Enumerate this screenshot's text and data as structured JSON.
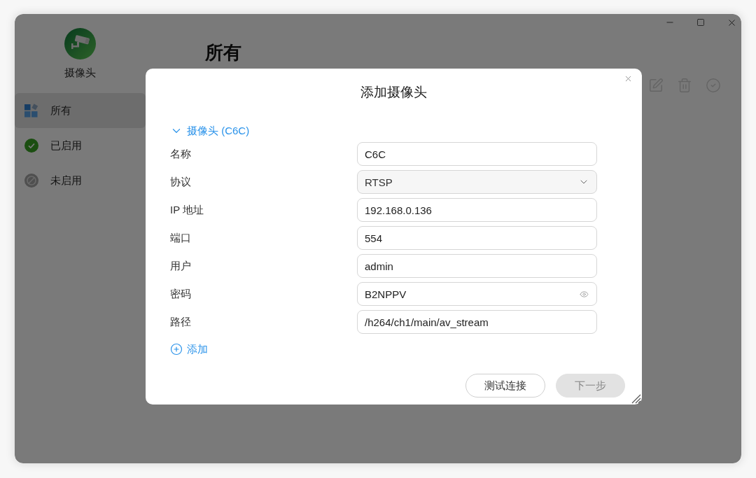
{
  "window": {
    "app_name": "摄像头",
    "page_title": "所有"
  },
  "sidebar": {
    "items": [
      {
        "label": "所有",
        "kind": "all",
        "selected": true
      },
      {
        "label": "已启用",
        "kind": "enabled",
        "selected": false
      },
      {
        "label": "未启用",
        "kind": "disabled",
        "selected": false
      }
    ]
  },
  "dialog": {
    "title": "添加摄像头",
    "section": {
      "title": "摄像头 (C6C)",
      "expanded": true
    },
    "fields": [
      {
        "label": "名称",
        "kind": "text",
        "value": "C6C"
      },
      {
        "label": "协议",
        "kind": "select",
        "value": "RTSP"
      },
      {
        "label": "IP 地址",
        "kind": "text",
        "value": "192.168.0.136"
      },
      {
        "label": "端口",
        "kind": "text",
        "value": "554"
      },
      {
        "label": "用户",
        "kind": "text",
        "value": "admin"
      },
      {
        "label": "密码",
        "kind": "password",
        "value": "B2NPPV"
      },
      {
        "label": "路径",
        "kind": "text",
        "value": "/h264/ch1/main/av_stream"
      }
    ],
    "add_label": "添加",
    "buttons": [
      {
        "label": "测试连接",
        "disabled": false
      },
      {
        "label": "下一步",
        "disabled": true
      }
    ]
  }
}
